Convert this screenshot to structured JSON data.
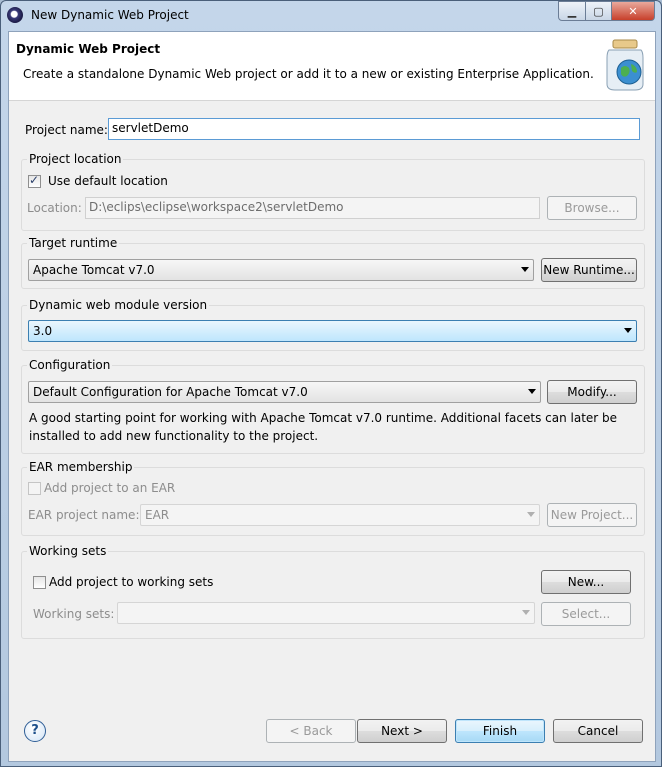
{
  "window": {
    "title": "New Dynamic Web Project"
  },
  "header": {
    "title": "Dynamic Web Project",
    "description": "Create a standalone Dynamic Web project or add it to a new or existing Enterprise Application."
  },
  "project_name": {
    "label": "Project name:",
    "value": "servletDemo"
  },
  "project_location": {
    "group_title": "Project location",
    "use_default_label": "Use default location",
    "use_default_checked": true,
    "location_label": "Location:",
    "location_value": "D:\\eclips\\eclipse\\workspace2\\servletDemo",
    "browse_label": "Browse..."
  },
  "target_runtime": {
    "group_title": "Target runtime",
    "selected": "Apache Tomcat v7.0",
    "new_runtime_label": "New Runtime..."
  },
  "module_version": {
    "group_title": "Dynamic web module version",
    "selected": "3.0"
  },
  "configuration": {
    "group_title": "Configuration",
    "selected": "Default Configuration for Apache Tomcat v7.0",
    "modify_label": "Modify...",
    "description": "A good starting point for working with Apache Tomcat v7.0 runtime. Additional facets can later be installed to add new functionality to the project."
  },
  "ear": {
    "group_title": "EAR membership",
    "add_label": "Add project to an EAR",
    "name_label": "EAR project name:",
    "name_value": "EAR",
    "new_project_label": "New Project..."
  },
  "working_sets": {
    "group_title": "Working sets",
    "add_label": "Add project to working sets",
    "new_label": "New...",
    "sets_label": "Working sets:",
    "select_label": "Select..."
  },
  "footer": {
    "back_label": "< Back",
    "next_label": "Next >",
    "finish_label": "Finish",
    "cancel_label": "Cancel"
  },
  "icons": {
    "app": "eclipse-icon",
    "header": "web-project-jar-icon",
    "help": "help-icon"
  },
  "colors": {
    "accent": "#3c7fb1",
    "focus_fill": "#bee6fd"
  }
}
